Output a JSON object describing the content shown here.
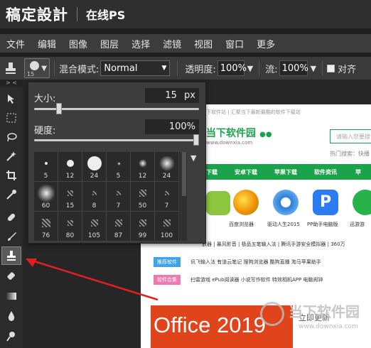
{
  "app": {
    "brand": "稿定設計",
    "subtitle": "在线PS"
  },
  "menu": [
    "文件",
    "编辑",
    "图像",
    "图层",
    "选择",
    "滤镜",
    "视图",
    "窗口",
    "更多"
  ],
  "options": {
    "brush_size_badge": "15",
    "blend_label": "混合模式:",
    "blend_value": "Normal",
    "opacity_label": "透明度:",
    "opacity_value": "100%",
    "flow_label": "流:",
    "flow_value": "100%",
    "align_label": "对齐"
  },
  "toolbar_collapse": "> <",
  "brush_panel": {
    "size_label": "大小:",
    "size_value": "15",
    "size_unit": "px",
    "size_fraction": 0.14,
    "hardness_label": "硬度:",
    "hardness_value": "100%",
    "hardness_fraction": 1.0,
    "presets": [
      {
        "label": "5",
        "kind": "hard",
        "d": 4
      },
      {
        "label": "12",
        "kind": "hard",
        "d": 10
      },
      {
        "label": "24",
        "kind": "hard",
        "d": 20
      },
      {
        "label": "5",
        "kind": "soft",
        "d": 5
      },
      {
        "label": "12",
        "kind": "soft",
        "d": 12
      },
      {
        "label": "24",
        "kind": "soft",
        "d": 22
      },
      {
        "label": "60",
        "kind": "soft",
        "d": 26
      },
      {
        "label": "15",
        "kind": "texture",
        "d": 8
      },
      {
        "label": "8",
        "kind": "texture",
        "d": 6
      },
      {
        "label": "7",
        "kind": "texture",
        "d": 6
      },
      {
        "label": "50",
        "kind": "texture",
        "d": 10
      },
      {
        "label": "7",
        "kind": "texture",
        "d": 6
      },
      {
        "label": "76",
        "kind": "texture",
        "d": 12
      },
      {
        "label": "80",
        "kind": "texture",
        "d": 8
      },
      {
        "label": "105",
        "kind": "texture",
        "d": 10
      },
      {
        "label": "87",
        "kind": "texture",
        "d": 10
      },
      {
        "label": "99",
        "kind": "texture",
        "d": 10
      },
      {
        "label": "100",
        "kind": "texture",
        "d": 10
      }
    ]
  },
  "webpage": {
    "top_strip": "下软件站 | 汇聚当下最新最酷的软件下载站",
    "logo_text": "当下软件园",
    "logo_url": "www.downxia.com",
    "search_placeholder": "请输入您要搜",
    "hot_search": "热门搜索：快播",
    "nav": [
      "下载",
      "安卓下载",
      "苹果下载",
      "软件资讯",
      "苹"
    ],
    "app_labels": [
      "",
      "百度浏览器",
      "驱动人生2015",
      "PP助手电脑版",
      "迅游游"
    ],
    "row_text": "放器 | 暴风影音 | 极品五笔输入法 | 腾讯手游安全模拟器 | 360万",
    "tag1": "推荐软件",
    "tag1_items": "讯飞输入法  有道云笔记  搜狗浏览器  酷狗直播  淘马苹果助手",
    "tag2": "软件合集",
    "tag2_items": "扫雷游戏  ePub阅读器  小说写作软件  特效相机APP  电脑闹钟",
    "banner": "Office 2019",
    "banner_side": "立即更新",
    "watermark": "当下软件园",
    "watermark_url": "www.downxia.com"
  },
  "colors": {
    "accent": "#1aa34a",
    "banner": "#e0441b",
    "arrow": "#e02020"
  }
}
